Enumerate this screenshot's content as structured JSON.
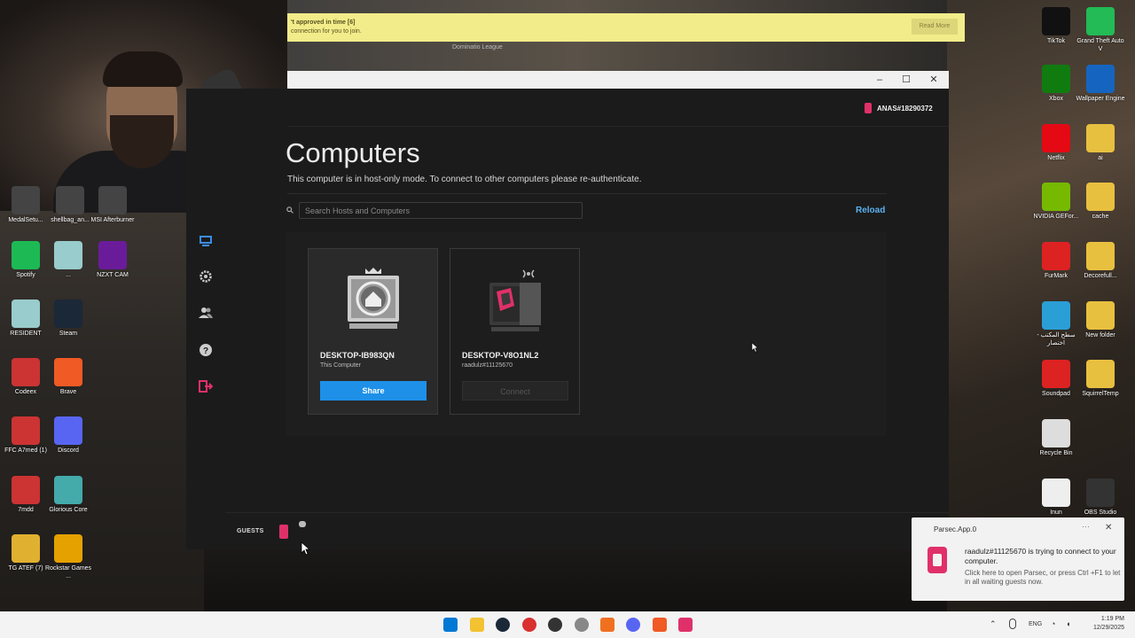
{
  "banner": {
    "line1": "'t approved in time [6]",
    "line2": "connection for you to join.",
    "read_more": "Read More",
    "bg_text": "Dominatio    League"
  },
  "window": {
    "minimize": "–",
    "maximize": "☐",
    "close": "✕"
  },
  "account": {
    "name": "ANAS#18290372"
  },
  "page": {
    "title": "Computers",
    "subtitle": "This computer is in host-only mode. To connect to other computers please re-authenticate."
  },
  "search": {
    "placeholder": "Search Hosts and Computers"
  },
  "reload_label": "Reload",
  "computers": [
    {
      "name": "DESKTOP-IB983QN",
      "sub": "This Computer",
      "action": "Share"
    },
    {
      "name": "DESKTOP-V8O1NL2",
      "sub": "raadulz#11125670",
      "action": "Connect"
    }
  ],
  "guests_label": "GUESTS",
  "desktop_left": [
    {
      "label": "MedalSetu...",
      "color": "#444"
    },
    {
      "label": "shellbag_an...",
      "color": "#444"
    },
    {
      "label": "MSI Afterburner",
      "color": "#444"
    },
    {
      "label": "Spotify",
      "color": "#1db954"
    },
    {
      "label": "...",
      "color": "#9cc"
    },
    {
      "label": "NZXT CAM",
      "color": "#6a1b9a"
    },
    {
      "label": "RESIDENT",
      "color": "#9cc"
    },
    {
      "label": "Steam",
      "color": "#1b2838"
    },
    {
      "label": "Codeex",
      "color": "#c33"
    },
    {
      "label": "Brave",
      "color": "#f05a24"
    },
    {
      "label": "FFC A7med (1)",
      "color": "#c33"
    },
    {
      "label": "Discord",
      "color": "#5865f2"
    },
    {
      "label": "7mdd",
      "color": "#c33"
    },
    {
      "label": "Glorious Core",
      "color": "#4aa"
    },
    {
      "label": "TG ATEF (7)",
      "color": "#e0b030"
    },
    {
      "label": "Rockstar Games ...",
      "color": "#e5a100"
    }
  ],
  "desktop_right": [
    {
      "label": "TikTok",
      "color": "#111"
    },
    {
      "label": "Grand Theft Auto V",
      "color": "#2b5"
    },
    {
      "label": "Xbox",
      "color": "#107c10"
    },
    {
      "label": "Wallpaper Engine",
      "color": "#1565c0"
    },
    {
      "label": "Netflix",
      "color": "#e50914"
    },
    {
      "label": "ai",
      "color": "#e8c040"
    },
    {
      "label": "NVIDIA GEFor...",
      "color": "#76b900"
    },
    {
      "label": "cache",
      "color": "#e8c040"
    },
    {
      "label": "FurMark",
      "color": "#d22"
    },
    {
      "label": "Decorefull...",
      "color": "#e8c040"
    },
    {
      "label": "سطح المكتب - اختصار",
      "color": "#2a9fd6"
    },
    {
      "label": "New folder",
      "color": "#e8c040"
    },
    {
      "label": "Soundpad",
      "color": "#d22"
    },
    {
      "label": "SquirrelTemp",
      "color": "#e8c040"
    },
    {
      "label": "Recycle Bin",
      "color": "#ddd"
    },
    {
      "label": "Inun",
      "color": "#eee"
    },
    {
      "label": "OBS Studio",
      "color": "#333"
    }
  ],
  "toast": {
    "app": "Parsec.App.0",
    "dots": "···",
    "close": "✕",
    "message": "raadulz#11125670 is trying to connect to your computer.",
    "hint": "Click here to open Parsec, or press Ctrl +F1 to let in all waiting guests now."
  },
  "taskbar": {
    "apps": [
      "start-icon",
      "file-explorer-icon",
      "steam-icon",
      "app-red-icon",
      "app-dark-icon",
      "settings-icon",
      "app-orange-icon",
      "discord-icon",
      "brave-icon",
      "parsec-icon"
    ],
    "lang": "ENG",
    "time": "1:19 PM",
    "date": "12/29/2025"
  },
  "colors": {
    "accent": "#1e90e8",
    "parsec_pink": "#e0306a",
    "banner": "#f2ec8a"
  }
}
